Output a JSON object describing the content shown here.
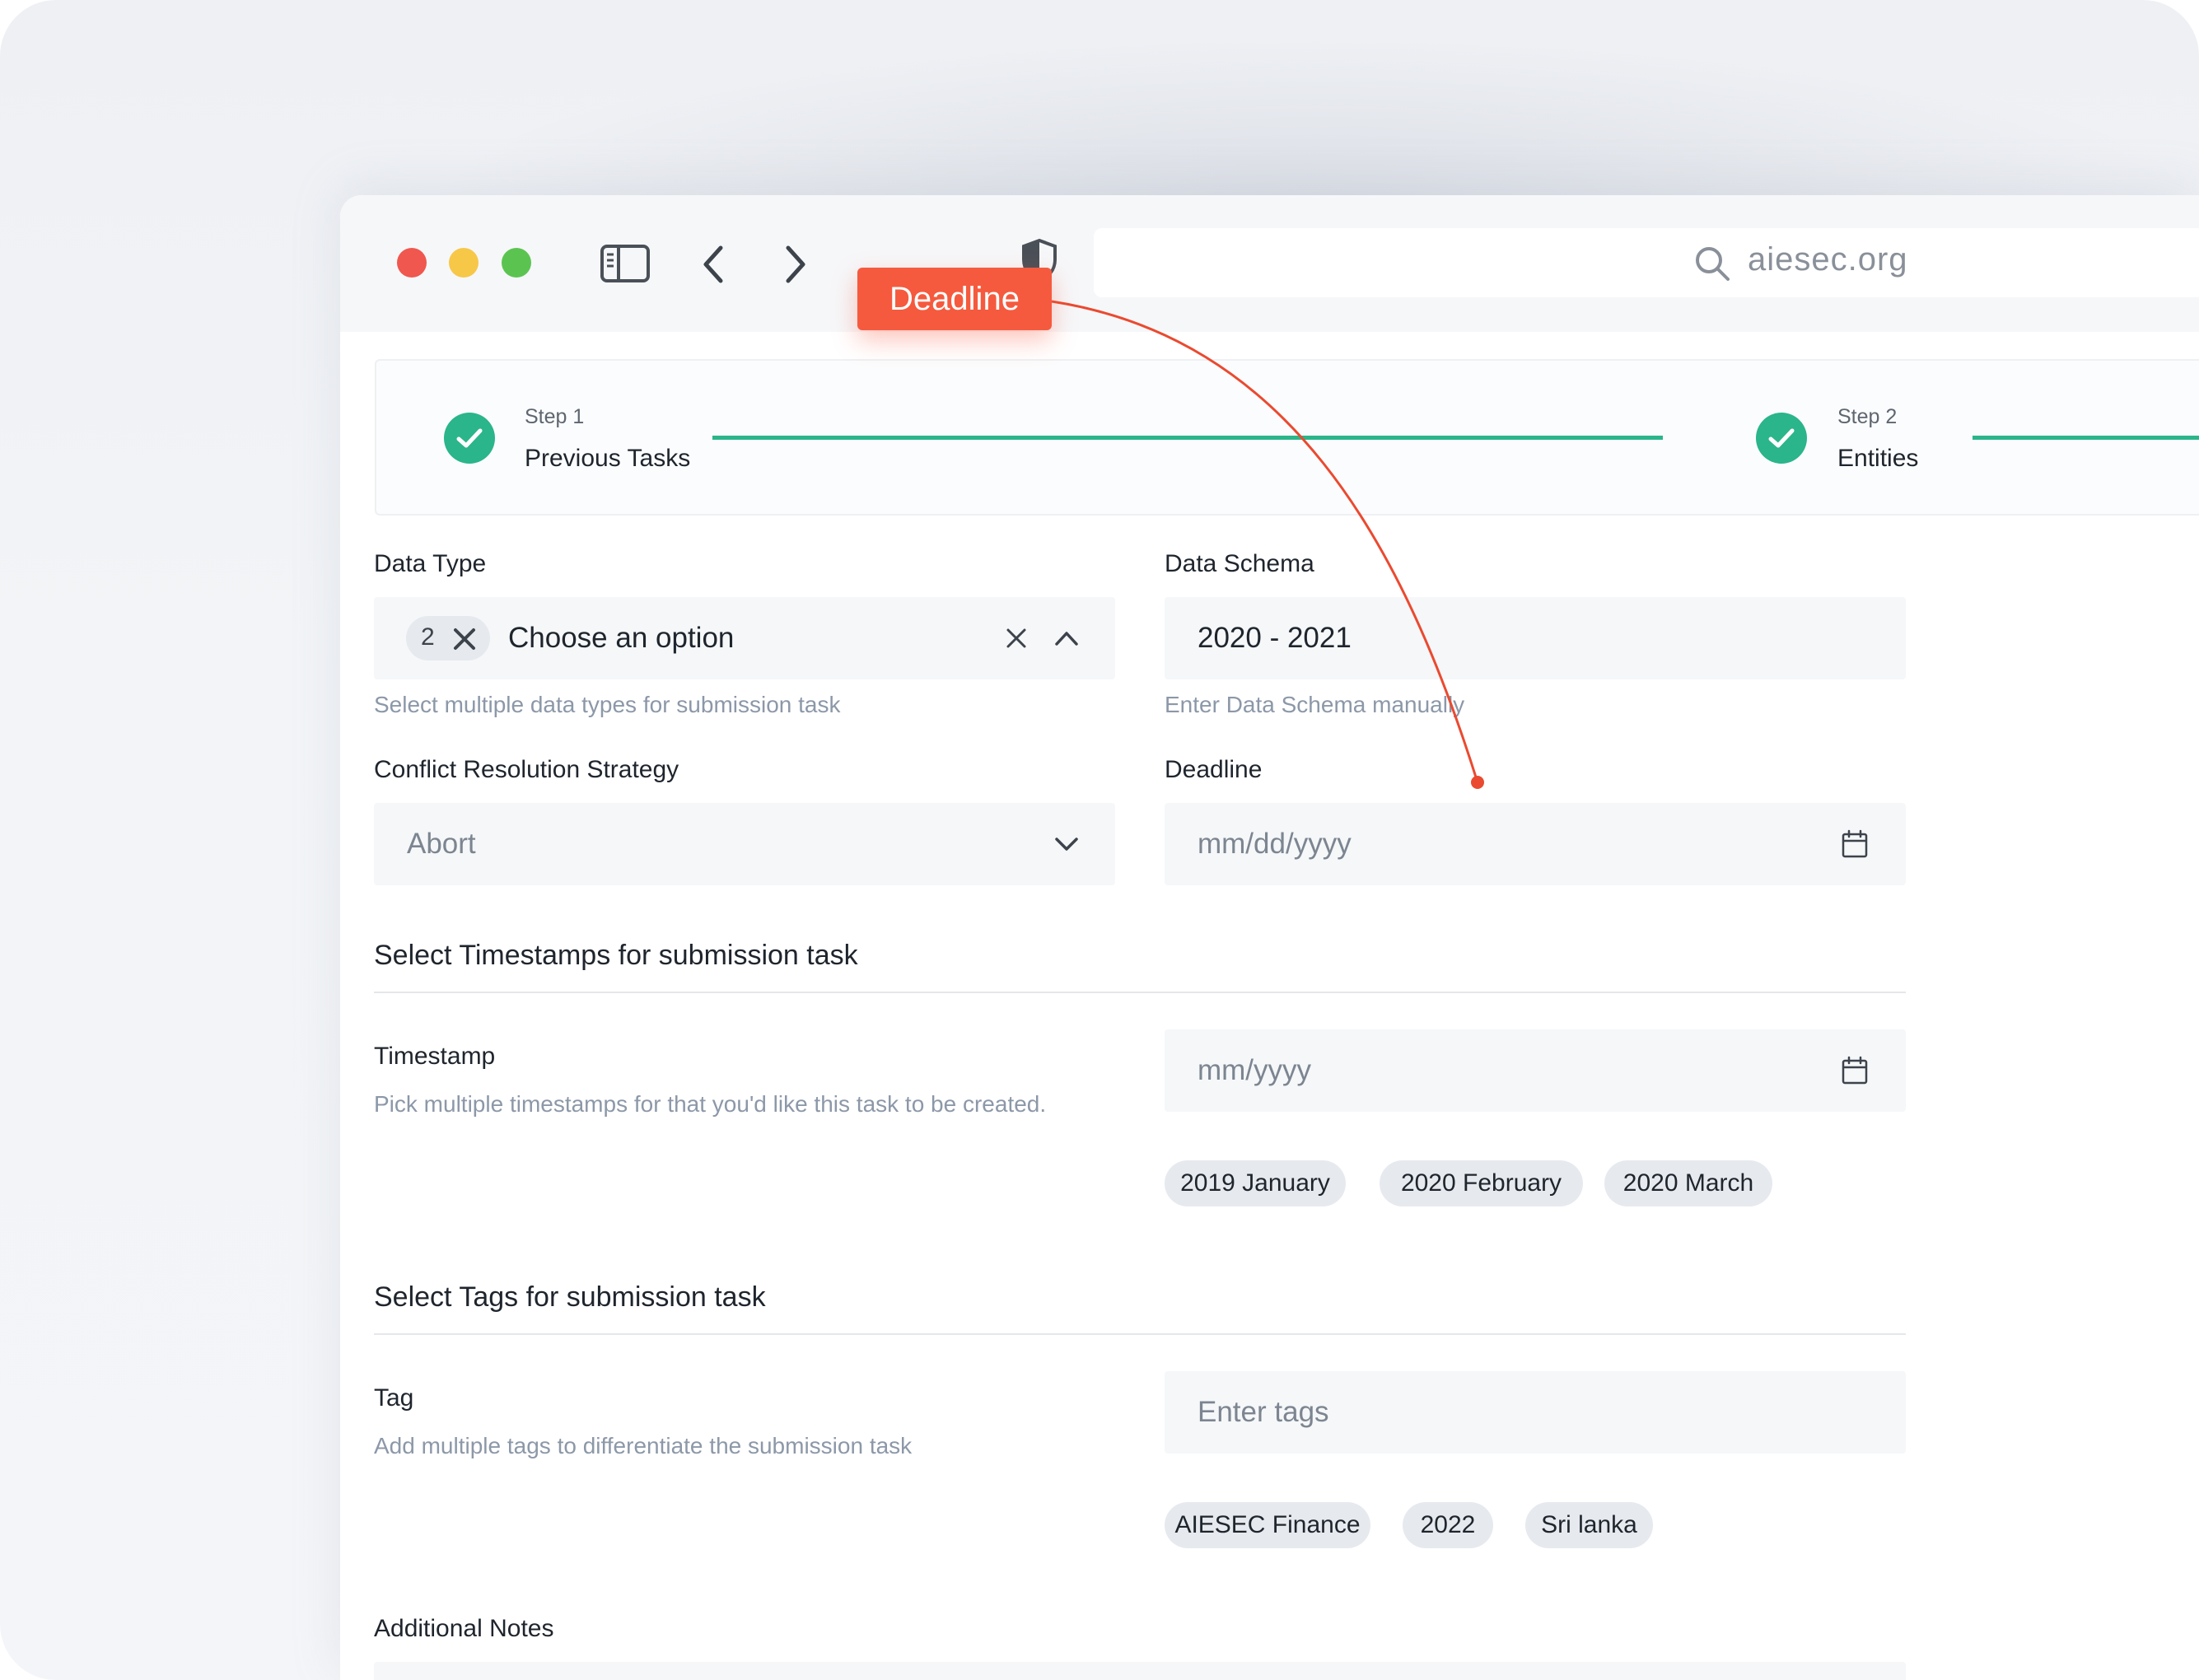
{
  "browser": {
    "address": "aiesec.org"
  },
  "stepper": {
    "steps": [
      {
        "small": "Step 1",
        "label": "Previous Tasks"
      },
      {
        "small": "Step 2",
        "label": "Entities"
      }
    ]
  },
  "form": {
    "data_type": {
      "label": "Data Type",
      "count": "2",
      "placeholder": "Choose an option",
      "help": "Select multiple data types for submission task"
    },
    "data_schema": {
      "label": "Data Schema",
      "value": "2020 - 2021",
      "help": "Enter Data Schema manually"
    },
    "conflict": {
      "label": "Conflict Resolution Strategy",
      "value": "Abort"
    },
    "deadline": {
      "label": "Deadline",
      "placeholder": "mm/dd/yyyy"
    },
    "timestamps_section": {
      "title": "Select Timestamps for submission task",
      "label": "Timestamp",
      "help": "Pick multiple timestamps for that you'd like this task to be created.",
      "placeholder": "mm/yyyy",
      "chips": [
        "2019 January",
        "2020 February",
        "2020 March"
      ]
    },
    "tags_section": {
      "title": "Select Tags for submission task",
      "label": "Tag",
      "help": "Add multiple tags to differentiate the submission task",
      "placeholder": "Enter tags",
      "chips": [
        "AIESEC Finance",
        "2022",
        "Sri lanka"
      ]
    },
    "notes": {
      "label": "Additional Notes"
    }
  },
  "annotation": {
    "label": "Deadline"
  },
  "colors": {
    "accent_green": "#2ab58a",
    "callout_red": "#f55a3e"
  },
  "icons": {
    "sidebar": "sidebar-icon",
    "back": "chevron-left-icon",
    "forward": "chevron-right-icon",
    "shield": "shield-icon",
    "search": "search-icon",
    "calendar": "calendar-icon"
  }
}
